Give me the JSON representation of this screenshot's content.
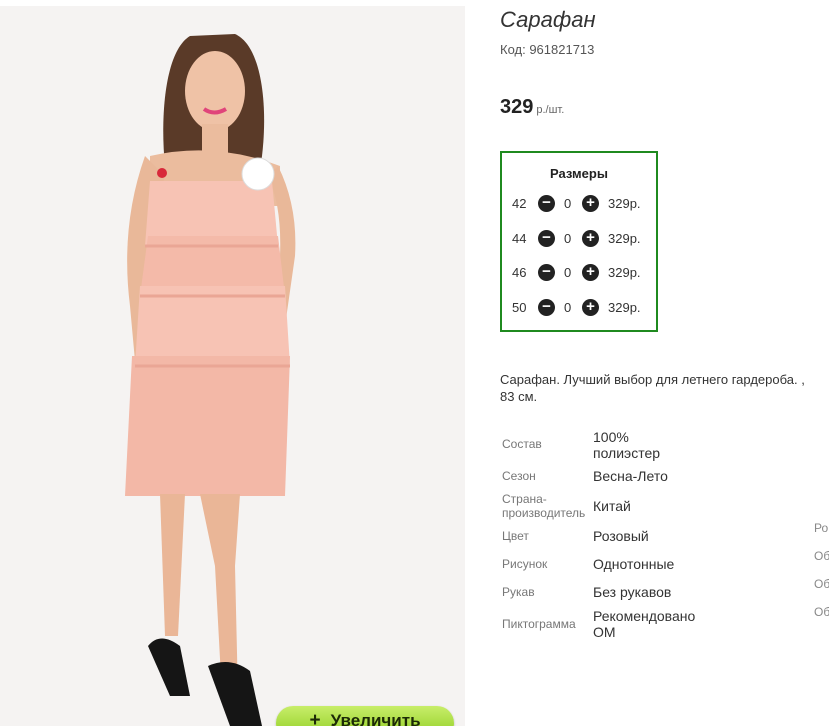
{
  "product": {
    "title": "Сарафан",
    "code": "Код: 961821713",
    "price": "329",
    "price_unit": "р./шт."
  },
  "sizes": {
    "title": "Размеры",
    "rows": [
      {
        "size": "42",
        "qty": "0",
        "price": "329р."
      },
      {
        "size": "44",
        "qty": "0",
        "price": "329р."
      },
      {
        "size": "46",
        "qty": "0",
        "price": "329р."
      },
      {
        "size": "50",
        "qty": "0",
        "price": "329р."
      }
    ]
  },
  "description": {
    "line1": "Сарафан. Лучший выбор для летнего гардероба. ,",
    "line2": "83 см."
  },
  "attributes": [
    {
      "label": "Состав",
      "value_lines": [
        "100%",
        "полиэстер"
      ]
    },
    {
      "label": "Сезон",
      "value_lines": [
        "Весна-Лето"
      ]
    },
    {
      "label_lines": [
        "Страна-",
        "производитель"
      ],
      "value_lines": [
        "Китай"
      ]
    },
    {
      "label": "Цвет",
      "value_lines": [
        "Розовый"
      ]
    },
    {
      "label": "Рисунок",
      "value_lines": [
        "Однотонные"
      ]
    },
    {
      "label": "Рукав",
      "value_lines": [
        "Без рукавов"
      ]
    },
    {
      "label": "Пиктограмма",
      "value_lines": [
        "Рекомендовано",
        "ОМ"
      ]
    }
  ],
  "edge_labels": [
    "Ро",
    "Об",
    "Об",
    "Об"
  ],
  "zoom_button": {
    "icon": "+",
    "label": "Увеличить"
  },
  "colors": {
    "accent_green": "#1f8a1f",
    "button_green": "#9bd12a"
  }
}
